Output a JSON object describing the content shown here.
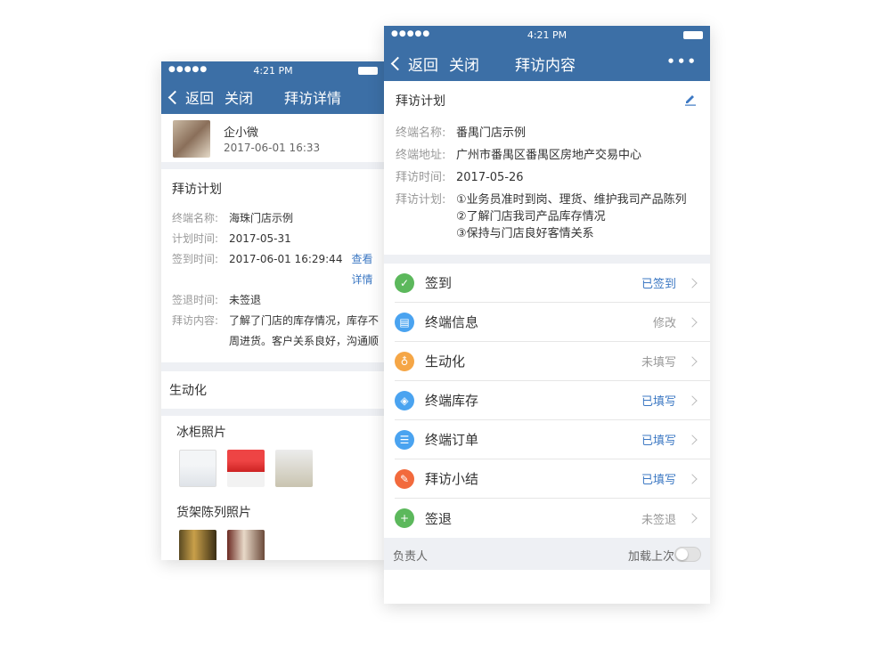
{
  "statusbar": {
    "signal": "●●●●● ",
    "time": "4:21 PM"
  },
  "left": {
    "nav": {
      "back": "返回",
      "close": "关闭",
      "title": "拜访详情"
    },
    "user": {
      "name": "企小微",
      "datetime": "2017-06-01 16:33"
    },
    "plan": {
      "title": "拜访计划",
      "rows": [
        {
          "k": "终端名称:",
          "v": "海珠门店示例"
        },
        {
          "k": "计划时间:",
          "v": "2017-05-31"
        },
        {
          "k": "签到时间:",
          "v": "2017-06-01 16:29:44",
          "link": "查看详情"
        },
        {
          "k": "签退时间:",
          "v": "未签退"
        },
        {
          "k": "拜访内容:",
          "v": "了解了门店的库存情况，库存不",
          "v2": "周进货。客户关系良好，沟通顺"
        }
      ]
    },
    "vivid": "生动化",
    "photos": {
      "fridge": "冰柜照片",
      "shelf": "货架陈列照片"
    }
  },
  "right": {
    "nav": {
      "back": "返回",
      "close": "关闭",
      "title": "拜访内容",
      "more": "•••"
    },
    "plan": {
      "title": "拜访计划",
      "rows": [
        {
          "k": "终端名称:",
          "v": "番禺门店示例"
        },
        {
          "k": "终端地址:",
          "v": "广州市番禺区番禺区房地产交易中心"
        },
        {
          "k": "拜访时间:",
          "v": "2017-05-26"
        },
        {
          "k": "拜访计划:",
          "v": "①业务员准时到岗、理货、维护我司产品陈列",
          "v2": "②了解门店我司产品库存情况",
          "v3": "③保持与门店良好客情关系"
        }
      ]
    },
    "items": [
      {
        "label": "签到",
        "status": "已签到",
        "icon": "calendar-check-icon",
        "color": "#5cb85c",
        "status_color": "#3c78c3"
      },
      {
        "label": "终端信息",
        "status": "修改",
        "icon": "id-card-icon",
        "color": "#4aa3f0",
        "status_color": "#999999"
      },
      {
        "label": "生动化",
        "status": "未填写",
        "icon": "bulb-icon",
        "color": "#f5a646",
        "status_color": "#999999"
      },
      {
        "label": "终端库存",
        "status": "已填写",
        "icon": "box-icon",
        "color": "#4aa3f0",
        "status_color": "#3c78c3"
      },
      {
        "label": "终端订单",
        "status": "已填写",
        "icon": "clipboard-icon",
        "color": "#4aa3f0",
        "status_color": "#3c78c3"
      },
      {
        "label": "拜访小结",
        "status": "已填写",
        "icon": "note-icon",
        "color": "#f26a3d",
        "status_color": "#3c78c3"
      },
      {
        "label": "签退",
        "status": "未签退",
        "icon": "calendar-out-icon",
        "color": "#5cb85c",
        "status_color": "#999999"
      }
    ],
    "footer": {
      "left": "负责人",
      "right": "加载上次"
    }
  }
}
